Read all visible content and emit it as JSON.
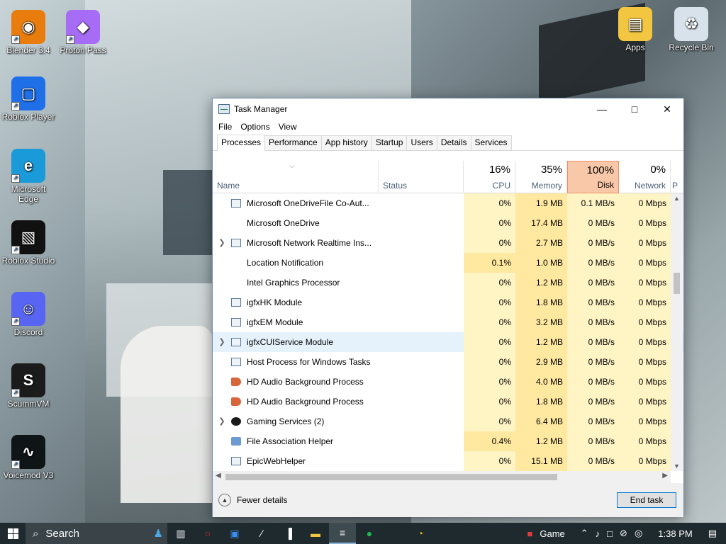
{
  "desktop": {
    "icons": [
      {
        "label": "Blender 3.4",
        "color": "#e87d0d",
        "glyph": "◉"
      },
      {
        "label": "Proton Pass",
        "color": "#a66cf5",
        "glyph": "◆"
      },
      {
        "label": "Roblox Player",
        "color": "#1e6fe8",
        "glyph": "▢"
      },
      {
        "label": "Microsoft Edge",
        "color": "#1a9ad8",
        "glyph": "e"
      },
      {
        "label": "Roblox Studio",
        "color": "#111111",
        "glyph": "▧"
      },
      {
        "label": "Discord",
        "color": "#5865f2",
        "glyph": "☺"
      },
      {
        "label": "ScummVM",
        "color": "#1b1b1b",
        "glyph": "S"
      },
      {
        "label": "Voicemod V3",
        "color": "#0f1416",
        "glyph": "∿"
      },
      {
        "label": "Apps",
        "color": "#f3c642",
        "glyph": "▤"
      },
      {
        "label": "Recycle Bin",
        "color": "#d8e2ea",
        "glyph": "♻"
      }
    ]
  },
  "window": {
    "title": "Task Manager",
    "menu": [
      "File",
      "Options",
      "View"
    ],
    "tabs": [
      "Processes",
      "Performance",
      "App history",
      "Startup",
      "Users",
      "Details",
      "Services"
    ],
    "active_tab": "Processes",
    "columns": {
      "name": "Name",
      "status": "Status",
      "cpu": {
        "pct": "16%",
        "label": "CPU"
      },
      "memory": {
        "pct": "35%",
        "label": "Memory"
      },
      "disk": {
        "pct": "100%",
        "label": "Disk"
      },
      "network": {
        "pct": "0%",
        "label": "Network"
      },
      "power": "P"
    },
    "rows": [
      {
        "name": "Microsoft OneDriveFile Co-Aut...",
        "expandable": false,
        "icon": "app",
        "cpu": "0%",
        "mem": "1.9 MB",
        "disk": "0.1 MB/s",
        "net": "0 Mbps"
      },
      {
        "name": "Microsoft OneDrive",
        "expandable": false,
        "icon": "none",
        "cpu": "0%",
        "mem": "17.4 MB",
        "disk": "0 MB/s",
        "net": "0 Mbps"
      },
      {
        "name": "Microsoft Network Realtime Ins...",
        "expandable": true,
        "icon": "app",
        "cpu": "0%",
        "mem": "2.7 MB",
        "disk": "0 MB/s",
        "net": "0 Mbps"
      },
      {
        "name": "Location Notification",
        "expandable": false,
        "icon": "none",
        "cpu": "0.1%",
        "mem": "1.0 MB",
        "disk": "0 MB/s",
        "net": "0 Mbps"
      },
      {
        "name": "Intel Graphics Processor",
        "expandable": false,
        "icon": "none",
        "cpu": "0%",
        "mem": "1.2 MB",
        "disk": "0 MB/s",
        "net": "0 Mbps"
      },
      {
        "name": "igfxHK Module",
        "expandable": false,
        "icon": "app",
        "cpu": "0%",
        "mem": "1.8 MB",
        "disk": "0 MB/s",
        "net": "0 Mbps"
      },
      {
        "name": "igfxEM Module",
        "expandable": false,
        "icon": "app",
        "cpu": "0%",
        "mem": "3.2 MB",
        "disk": "0 MB/s",
        "net": "0 Mbps"
      },
      {
        "name": "igfxCUIService Module",
        "expandable": true,
        "icon": "app",
        "cpu": "0%",
        "mem": "1.2 MB",
        "disk": "0 MB/s",
        "net": "0 Mbps",
        "selected": true
      },
      {
        "name": "Host Process for Windows Tasks",
        "expandable": false,
        "icon": "app",
        "cpu": "0%",
        "mem": "2.9 MB",
        "disk": "0 MB/s",
        "net": "0 Mbps"
      },
      {
        "name": "HD Audio Background Process",
        "expandable": false,
        "icon": "speaker",
        "cpu": "0%",
        "mem": "4.0 MB",
        "disk": "0 MB/s",
        "net": "0 Mbps"
      },
      {
        "name": "HD Audio Background Process",
        "expandable": false,
        "icon": "speaker",
        "cpu": "0%",
        "mem": "1.8 MB",
        "disk": "0 MB/s",
        "net": "0 Mbps"
      },
      {
        "name": "Gaming Services (2)",
        "expandable": true,
        "icon": "xbox",
        "cpu": "0%",
        "mem": "6.4 MB",
        "disk": "0 MB/s",
        "net": "0 Mbps"
      },
      {
        "name": "File Association Helper",
        "expandable": false,
        "icon": "gear",
        "cpu": "0.4%",
        "mem": "1.2 MB",
        "disk": "0 MB/s",
        "net": "0 Mbps"
      },
      {
        "name": "EpicWebHelper",
        "expandable": false,
        "icon": "app",
        "cpu": "0%",
        "mem": "15.1 MB",
        "disk": "0 MB/s",
        "net": "0 Mbps"
      }
    ],
    "footer": {
      "fewer_details": "Fewer details",
      "end_task": "End task"
    }
  },
  "taskbar": {
    "search_label": "Search",
    "weather_text": "Game",
    "clock": "1:38 PM",
    "colors": {
      "bg": "#1f2a2e",
      "accent": "#8ab4d8"
    }
  }
}
